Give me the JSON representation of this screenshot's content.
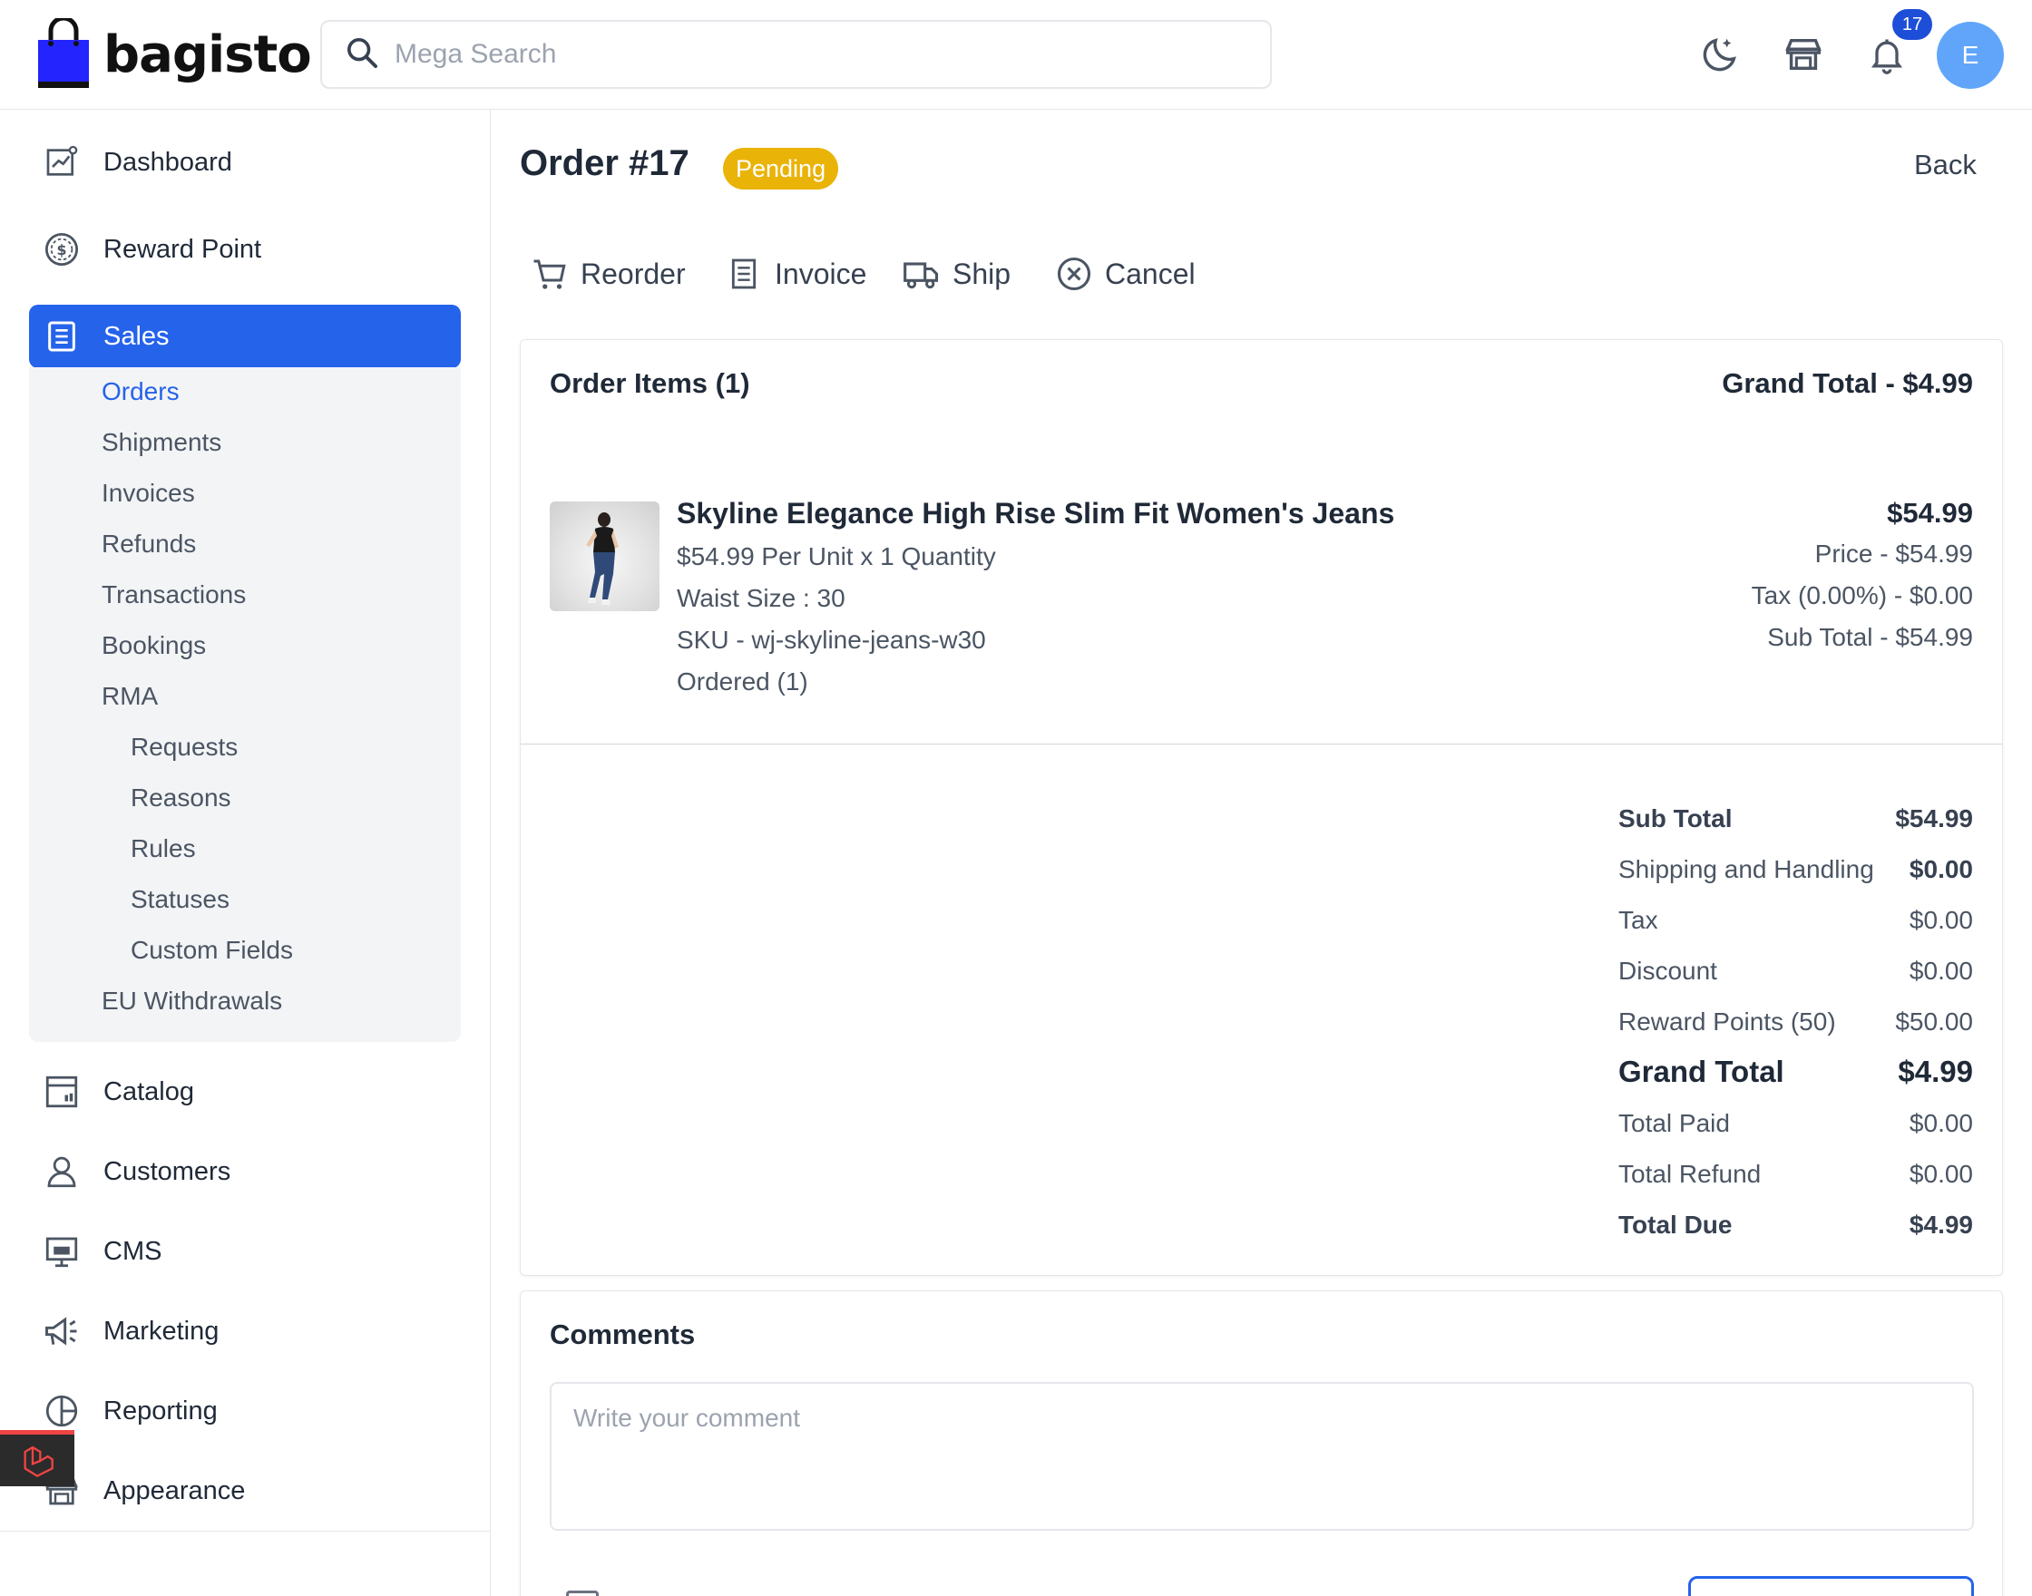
{
  "brand": {
    "name": "bagisto"
  },
  "header": {
    "search_placeholder": "Mega Search",
    "notifications_count": "17",
    "avatar_initial": "E",
    "icons": [
      "dark-mode-icon",
      "storefront-icon",
      "bell-icon"
    ]
  },
  "sidebar": {
    "items": [
      {
        "label": "Dashboard",
        "icon": "dashboard-icon"
      },
      {
        "label": "Reward Point",
        "icon": "reward-point-icon"
      },
      {
        "label": "Sales",
        "icon": "sales-icon",
        "active": true
      },
      {
        "label": "Catalog",
        "icon": "catalog-icon"
      },
      {
        "label": "Customers",
        "icon": "customers-icon"
      },
      {
        "label": "CMS",
        "icon": "cms-icon"
      },
      {
        "label": "Marketing",
        "icon": "marketing-icon"
      },
      {
        "label": "Reporting",
        "icon": "reporting-icon"
      },
      {
        "label": "Appearance",
        "icon": "appearance-icon"
      }
    ],
    "sales_sub": [
      "Orders",
      "Shipments",
      "Invoices",
      "Refunds",
      "Transactions",
      "Bookings",
      "RMA",
      "EU Withdrawals"
    ],
    "rma_sub": [
      "Requests",
      "Reasons",
      "Rules",
      "Statuses",
      "Custom Fields"
    ]
  },
  "order": {
    "title": "Order #17",
    "status": "Pending",
    "back": "Back",
    "actions": [
      "Reorder",
      "Invoice",
      "Ship",
      "Cancel"
    ]
  },
  "items_card": {
    "title": "Order Items (1)",
    "grand_total": "Grand Total - $4.99",
    "item": {
      "name": "Skyline Elegance High Rise Slim Fit Women's Jeans",
      "per_unit": "$54.99 Per Unit x 1 Quantity",
      "attribute": "Waist Size : 30",
      "sku": "SKU - wj-skyline-jeans-w30",
      "ordered": "Ordered (1)",
      "total": "$54.99",
      "price": "Price - $54.99",
      "tax": "Tax (0.00%) - $0.00",
      "sub_total": "Sub Total - $54.99"
    }
  },
  "summary": [
    {
      "label": "Sub Total",
      "value": "$54.99"
    },
    {
      "label": "Shipping and Handling",
      "value": "$0.00"
    },
    {
      "label": "Tax",
      "value": "$0.00"
    },
    {
      "label": "Discount",
      "value": "$0.00"
    },
    {
      "label": "Reward Points (50)",
      "value": "$50.00"
    },
    {
      "label": "Grand Total",
      "value": "$4.99"
    },
    {
      "label": "Total Paid",
      "value": "$0.00"
    },
    {
      "label": "Total Refund",
      "value": "$0.00"
    },
    {
      "label": "Total Due",
      "value": "$4.99"
    }
  ],
  "comments": {
    "title": "Comments",
    "placeholder": "Write your comment"
  },
  "colors": {
    "accent": "#2563eb",
    "pending": "#eab308",
    "avatar": "#60a5fa"
  }
}
